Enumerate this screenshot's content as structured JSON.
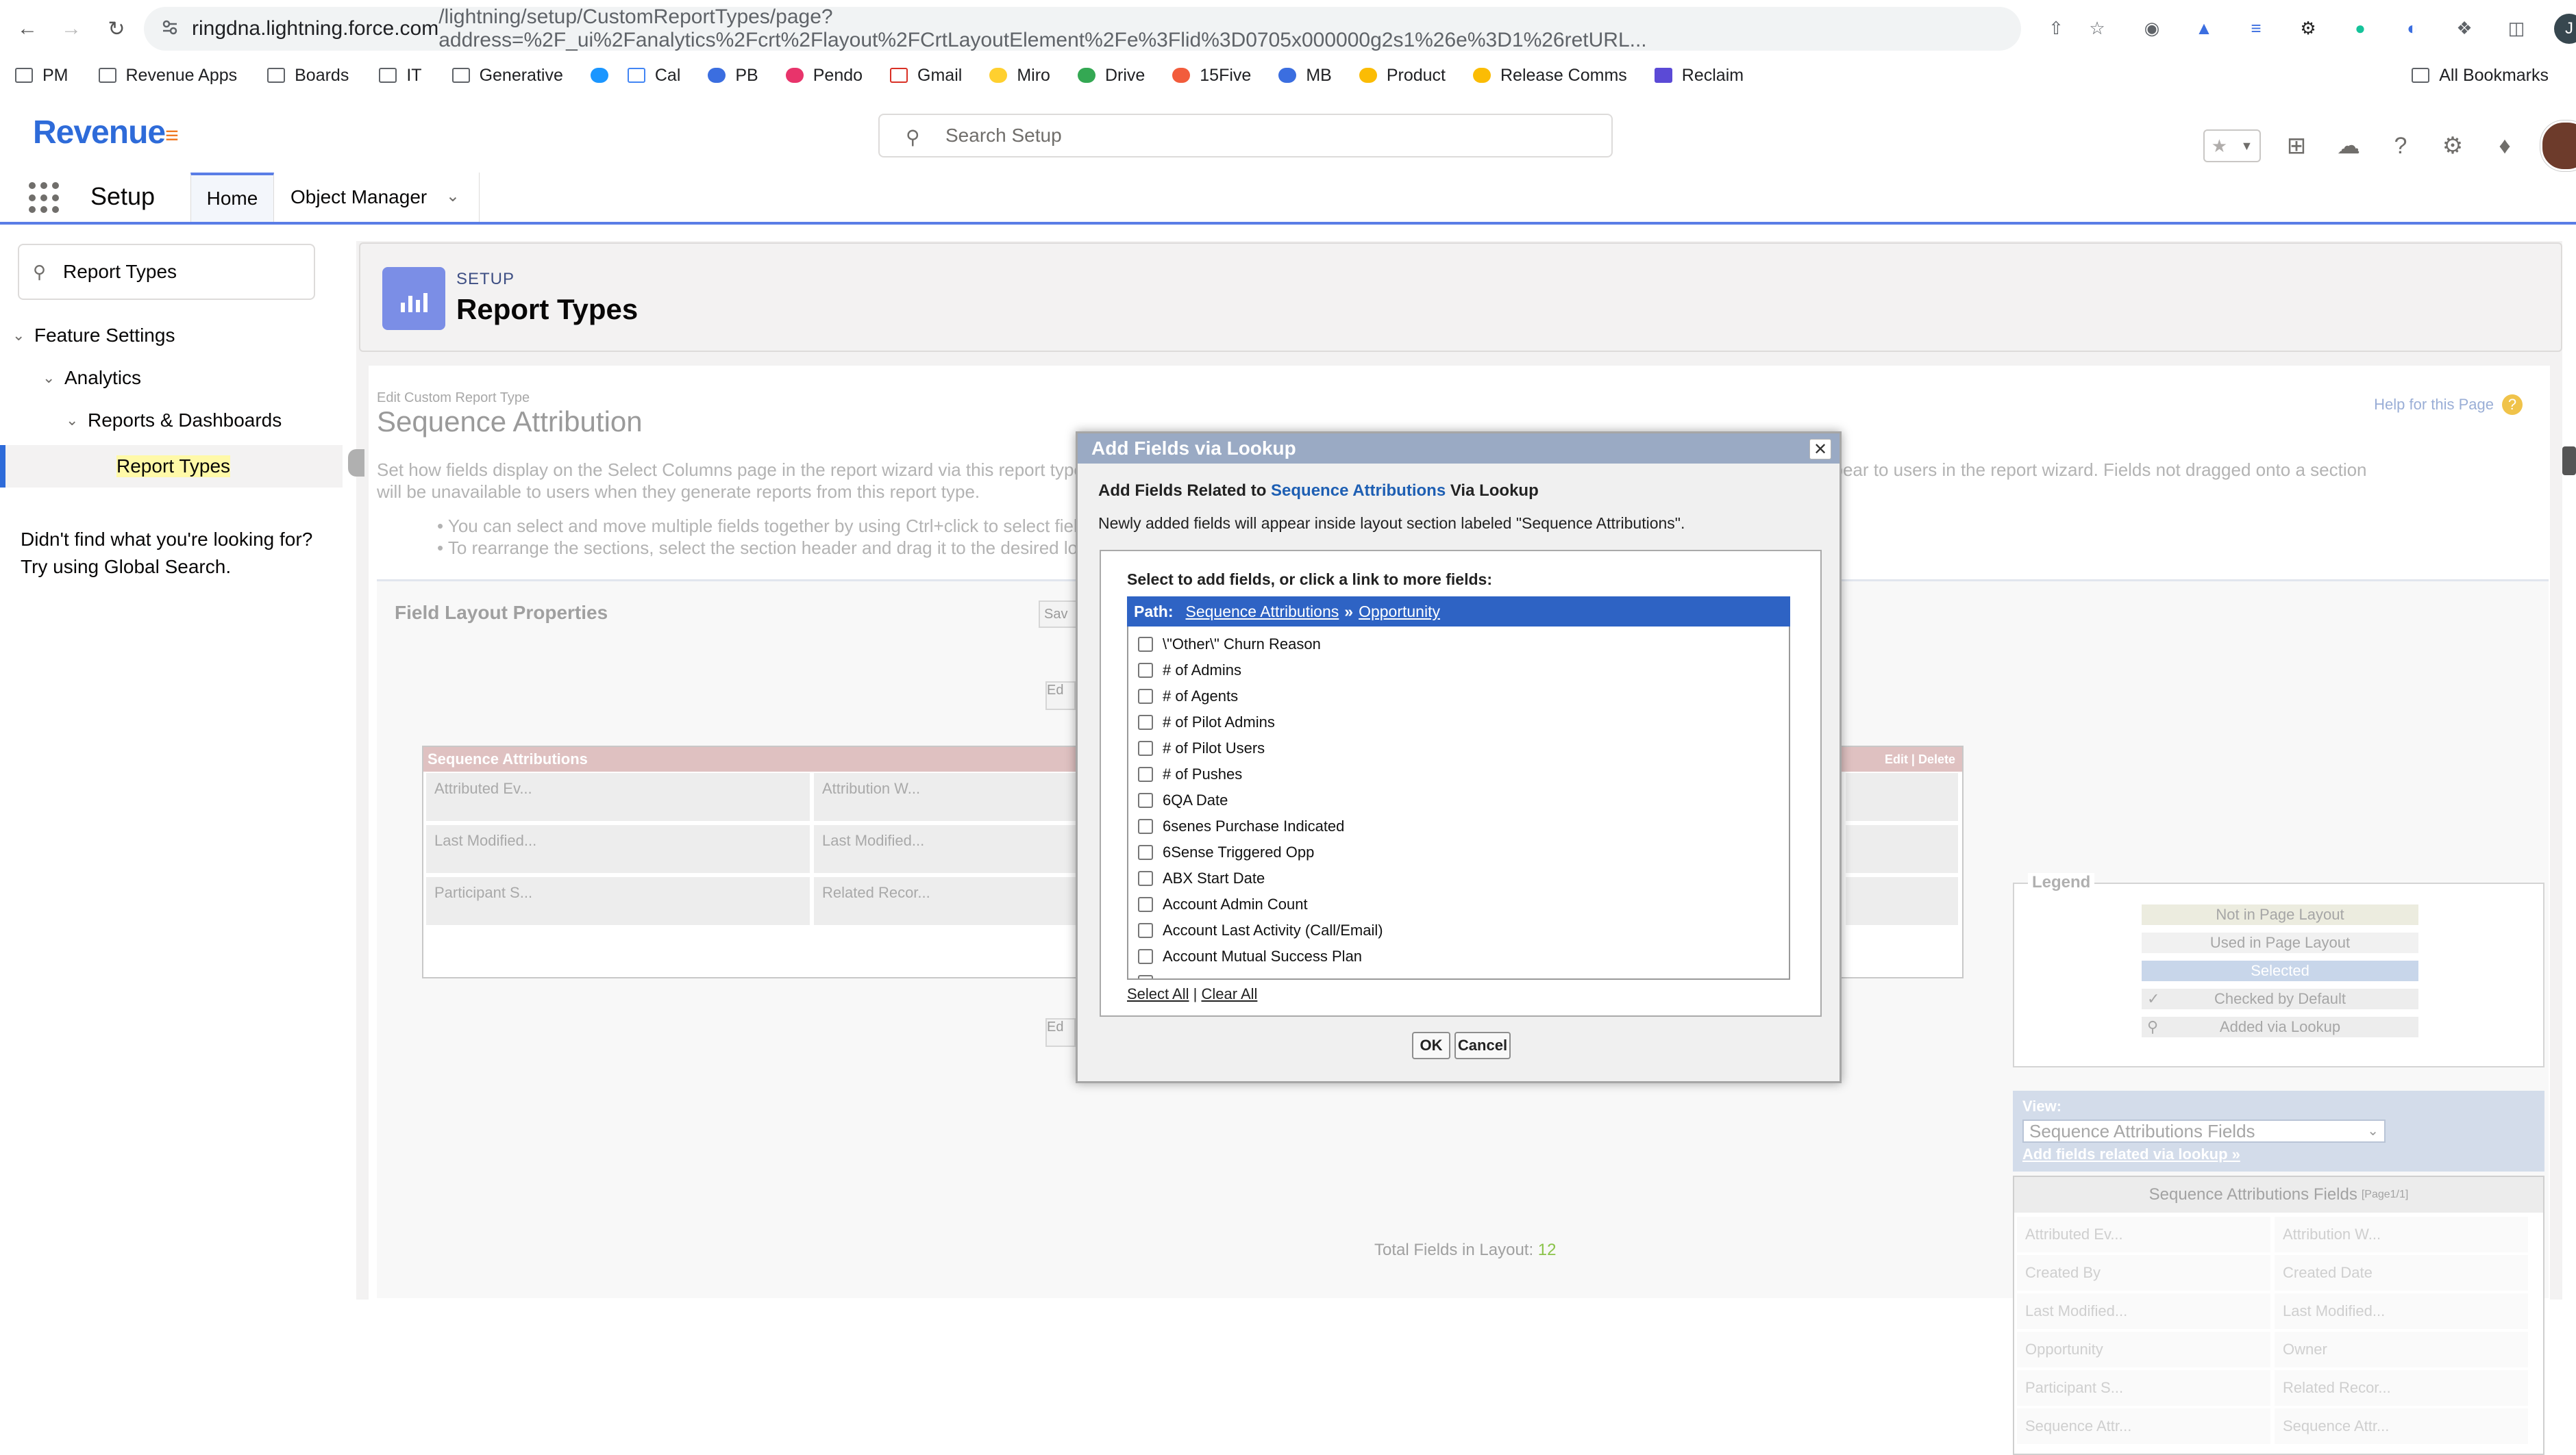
{
  "browser": {
    "url_domain": "ringdna.lightning.force.com",
    "url_path": "/lightning/setup/CustomReportTypes/page?address=%2F_ui%2Fanalytics%2Fcrt%2Flayout%2FCrtLayoutElement%2Fe%3Flid%3D0705x000000g2s1%26e%3D1%26retURL...",
    "profile_initial": "J"
  },
  "bookmarks": [
    {
      "label": "PM",
      "icon": "folder-icon"
    },
    {
      "label": "Revenue Apps",
      "icon": "folder-icon"
    },
    {
      "label": "Boards",
      "icon": "folder-icon"
    },
    {
      "label": "IT",
      "icon": "folder-icon"
    },
    {
      "label": "Generative",
      "icon": "folder-icon"
    },
    {
      "label": "",
      "icon": "salesforce-icon"
    },
    {
      "label": "Cal",
      "icon": "calendar-icon"
    },
    {
      "label": "PB",
      "icon": "pb-icon"
    },
    {
      "label": "Pendo",
      "icon": "pendo-icon"
    },
    {
      "label": "Gmail",
      "icon": "gmail-icon"
    },
    {
      "label": "Miro",
      "icon": "miro-icon"
    },
    {
      "label": "Drive",
      "icon": "drive-icon"
    },
    {
      "label": "15Five",
      "icon": "fifteen-five-icon"
    },
    {
      "label": "MB",
      "icon": "mb-icon"
    },
    {
      "label": "Product",
      "icon": "drive-icon"
    },
    {
      "label": "Release Comms",
      "icon": "drive-icon"
    },
    {
      "label": "Reclaim",
      "icon": "reclaim-icon"
    }
  ],
  "all_bookmarks": "All Bookmarks",
  "header": {
    "logo": "Revenue",
    "search_placeholder": "Search Setup"
  },
  "nav": {
    "app_name": "Setup",
    "tabs": [
      "Home",
      "Object Manager"
    ]
  },
  "sidebar": {
    "quickfind_value": "Report Types",
    "tree": [
      "Feature Settings",
      "Analytics",
      "Reports & Dashboards",
      "Report Types"
    ],
    "help_line1": "Didn't find what you're looking for?",
    "help_line2": "Try using Global Search."
  },
  "setup_header": {
    "crumb": "SETUP",
    "title": "Report Types"
  },
  "crt": {
    "subtitle": "Edit Custom Report Type",
    "title": "Sequence Attribution",
    "help_link": "Help for this Page",
    "description_start": "Set how fields display on the Select Columns page in the report wizard via this report type by",
    "description_end": "ctions as they should appear to users in the report wizard. Fields not dragged onto a section",
    "description_line2": "will be unavailable to users when they generate reports from this report type.",
    "bullet1": "You can select and move multiple fields together by using Ctrl+click to select fields.",
    "bullet2": "To rearrange the sections, select the section header and drag it to the desired locat",
    "panel_title": "Field Layout Properties",
    "save_label": "Sav",
    "edit_label": "Ed",
    "section_name": "Sequence Attributions",
    "section_links": "Edit | Delete",
    "section_cells": [
      "Attributed Ev...",
      "Attribution W...",
      "Last Modified...",
      "Last Modified...",
      "Participant S...",
      "Related Recor..."
    ],
    "total_fields_label": "Total Fields in Layout:",
    "total_fields_value": "12"
  },
  "legend": {
    "title": "Legend",
    "items": [
      "Not in Page Layout",
      "Used in Page Layout",
      "Selected",
      "Checked by Default",
      "Added via Lookup"
    ]
  },
  "view_panel": {
    "label": "View:",
    "selected": "Sequence Attributions Fields",
    "link": "Add fields related via lookup »"
  },
  "fields_panel": {
    "title": "Sequence Attributions Fields",
    "page": "[Page1/1]",
    "cells": [
      "Attributed Ev...",
      "Attribution W...",
      "Created By",
      "Created Date",
      "Last Modified...",
      "Last Modified...",
      "Opportunity",
      "Owner",
      "Participant S...",
      "Related Recor...",
      "Sequence Attr...",
      "Sequence Attr..."
    ]
  },
  "modal": {
    "title": "Add Fields via Lookup",
    "sub_prefix": "Add Fields Related to",
    "sub_link": "Sequence Attributions",
    "sub_suffix": "Via Lookup",
    "note": "Newly added fields will appear inside layout section labeled \"Sequence Attributions\".",
    "picker_label": "Select to add fields, or click a link to more fields:",
    "path_label": "Path:",
    "path_link1": "Sequence Attributions",
    "path_sep": "»",
    "path_link2": "Opportunity",
    "fields": [
      "\\\"Other\\\" Churn Reason",
      "# of Admins",
      "# of Agents",
      "# of Pilot Admins",
      "# of Pilot Users",
      "# of Pushes",
      "6QA Date",
      "6senes Purchase Indicated",
      "6Sense Triggered Opp",
      "ABX Start Date",
      "Account Admin Count",
      "Account Last Activity (Call/Email)",
      "Account Mutual Success Plan"
    ],
    "select_all": "Select All",
    "divider": "|",
    "clear_all": "Clear All",
    "ok": "OK",
    "cancel": "Cancel"
  }
}
